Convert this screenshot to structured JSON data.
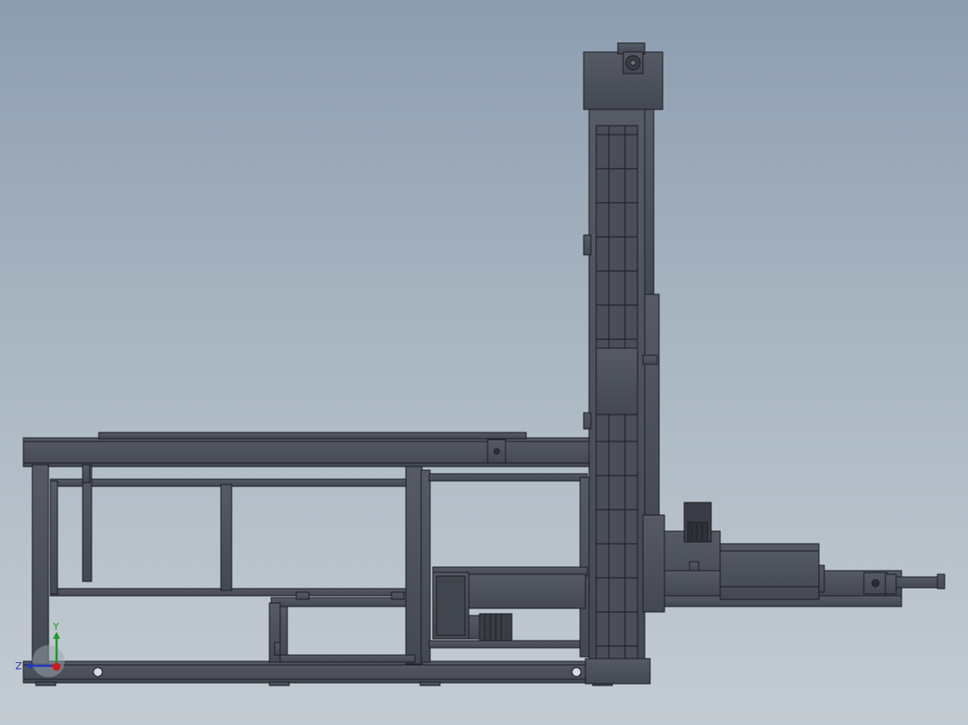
{
  "viewport": {
    "background_top": "#8d9db0",
    "background_bottom": "#c4ccd3",
    "model_color": "#4a4e59",
    "edge_color": "#1c1e24"
  },
  "triad": {
    "y_label": "Y",
    "z_label": "Z",
    "y_color": "#1f9a2a",
    "z_color": "#2438b8",
    "x_color": "#d11a1a"
  }
}
